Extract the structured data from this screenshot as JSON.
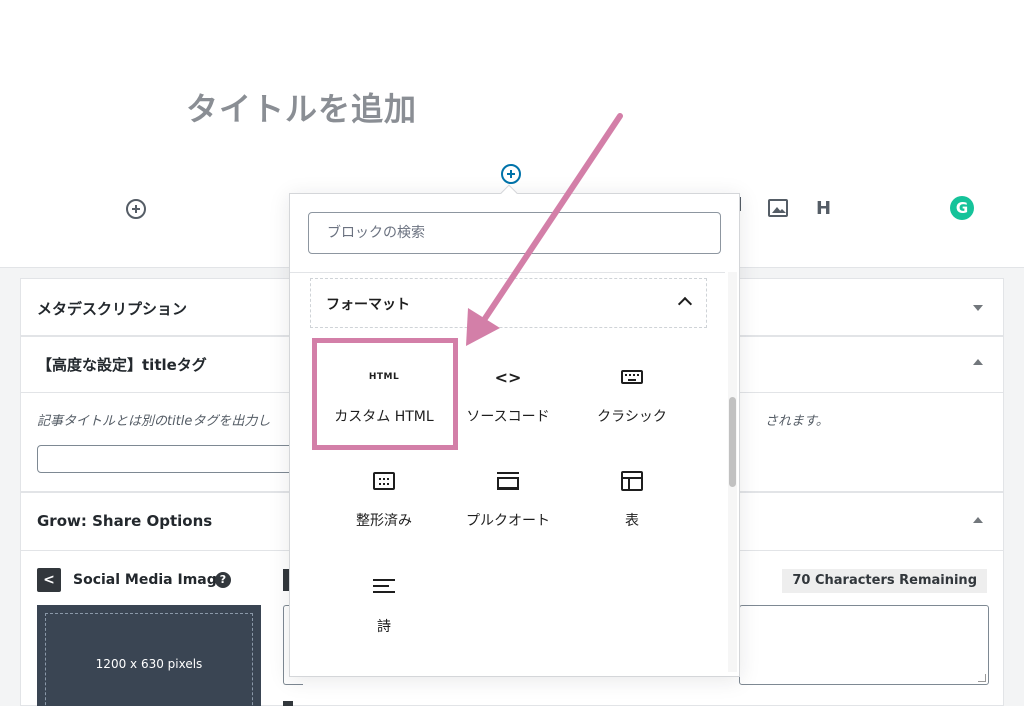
{
  "editor": {
    "title_placeholder": "タイトルを追加",
    "toolbar_heading_label": "H",
    "grammarly_label": "G"
  },
  "meta_panels": {
    "meta_description": {
      "title": "メタデスクリプション"
    },
    "advanced_settings": {
      "title": "【高度な設定】titleタグ",
      "description_left": "記事タイトルとは別のtitleタグを出力し",
      "description_right": "されます。"
    },
    "grow_share": {
      "title": "Grow: Share Options",
      "social_media_image_label": "Social Media Image",
      "help_label": "?",
      "image_size_label": "1200 x 630 pixels",
      "characters_remaining": "70 Characters Remaining"
    }
  },
  "inserter": {
    "search_placeholder": "ブロックの検索",
    "category_title": "フォーマット",
    "blocks": [
      {
        "label": "カスタム HTML",
        "icon": "html-icon",
        "icon_text": "HTML"
      },
      {
        "label": "ソースコード",
        "icon": "code-icon",
        "icon_text": "<>"
      },
      {
        "label": "クラシック",
        "icon": "keyboard-icon"
      },
      {
        "label": "整形済み",
        "icon": "preformatted-icon"
      },
      {
        "label": "プルクオート",
        "icon": "pullquote-icon"
      },
      {
        "label": "表",
        "icon": "table-icon"
      },
      {
        "label": "詩",
        "icon": "verse-icon"
      }
    ]
  },
  "annotation": {
    "highlight_color": "#d37fa8",
    "arrow_color": "#d37fa8"
  }
}
